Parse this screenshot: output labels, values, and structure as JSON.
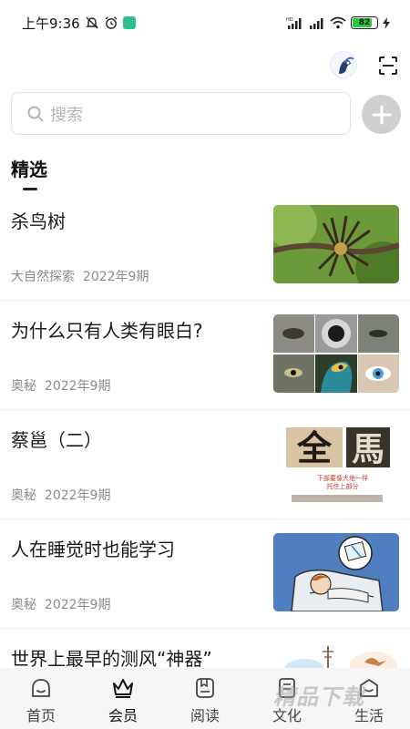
{
  "status_bar": {
    "time": "上午9:36",
    "battery_level": "82",
    "battery_fraction": 0.82
  },
  "search": {
    "placeholder": "搜索"
  },
  "section": {
    "title": "精选"
  },
  "articles": [
    {
      "title": "杀鸟树",
      "source": "大自然探索",
      "issue": "2022年9期"
    },
    {
      "title": "为什么只有人类有眼白?",
      "source": "奥秘",
      "issue": "2022年9期"
    },
    {
      "title": "蔡邕（二）",
      "source": "奥秘",
      "issue": "2022年9期"
    },
    {
      "title": "人在睡觉时也能学习",
      "source": "奥秘",
      "issue": "2022年9期"
    },
    {
      "title": "世界上最早的测风“神器”",
      "source": "",
      "issue": ""
    }
  ],
  "thumb_text": {
    "char_1": "全",
    "char_2": "馬",
    "caption_1": "下部要像大地一样",
    "caption_2": "托住上部分"
  },
  "bottom_nav": [
    {
      "label": "首页",
      "icon": "home-icon"
    },
    {
      "label": "会员",
      "icon": "crown-icon"
    },
    {
      "label": "阅读",
      "icon": "book-icon"
    },
    {
      "label": "文化",
      "icon": "culture-icon"
    },
    {
      "label": "生活",
      "icon": "life-icon"
    }
  ],
  "watermark": "精品下载",
  "colors": {
    "battery": "#27c93f",
    "app_badge": "#2fbf8a",
    "add_button": "#cfcfcf"
  }
}
